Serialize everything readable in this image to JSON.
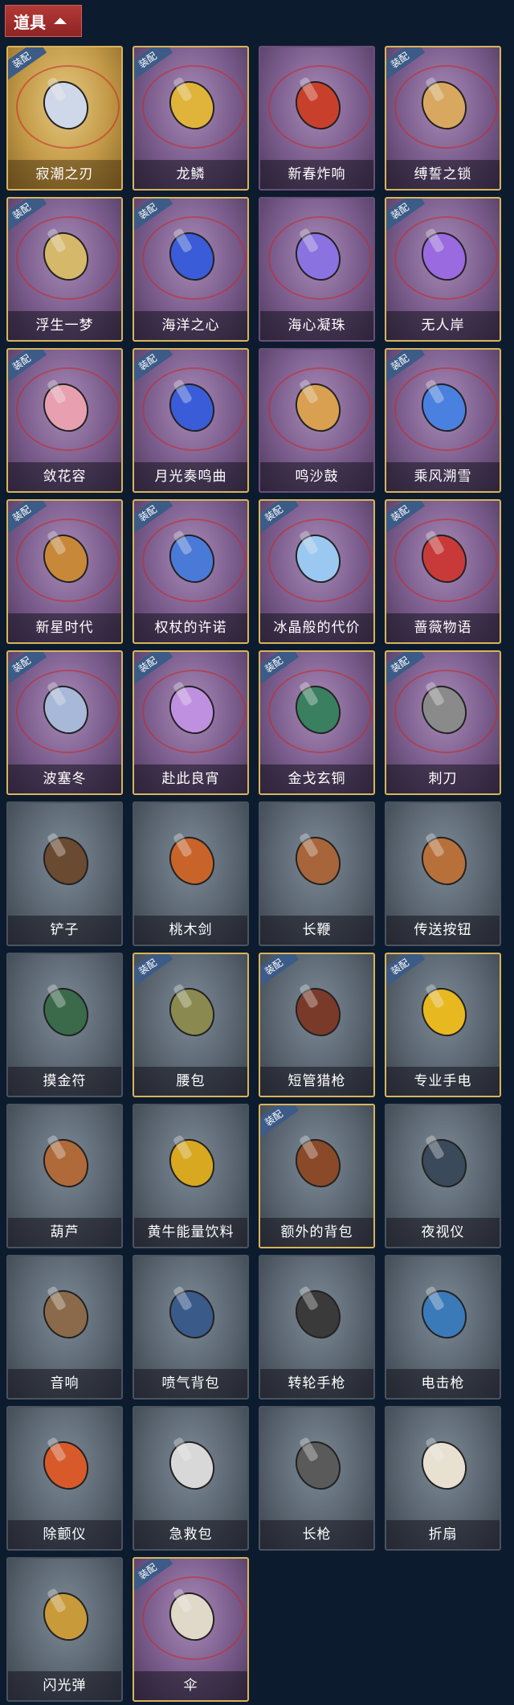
{
  "header": {
    "title": "道具"
  },
  "badge_text": "装配",
  "items": [
    {
      "label": "寂潮之刃",
      "style": "gold",
      "equipped": true,
      "icon": "blade-icon",
      "color": "#cfd8e8"
    },
    {
      "label": "龙鳞",
      "style": "purple",
      "equipped": true,
      "icon": "golden-shovel-icon",
      "color": "#e0b43a"
    },
    {
      "label": "新春炸响",
      "style": "purple",
      "equipped": false,
      "icon": "firecracker-whip-icon",
      "color": "#c8402c"
    },
    {
      "label": "缚誓之锁",
      "style": "purple",
      "equipped": true,
      "icon": "chain-lock-icon",
      "color": "#d8a860"
    },
    {
      "label": "浮生一梦",
      "style": "purple",
      "equipped": true,
      "icon": "scroll-icon",
      "color": "#d6b86a"
    },
    {
      "label": "海洋之心",
      "style": "purple",
      "equipped": true,
      "icon": "heart-necklace-icon",
      "color": "#3a5cd8"
    },
    {
      "label": "海心凝珠",
      "style": "purple",
      "equipped": false,
      "icon": "pearl-shell-icon",
      "color": "#8a72e0"
    },
    {
      "label": "无人岸",
      "style": "purple",
      "equipped": true,
      "icon": "perfume-bottle-icon",
      "color": "#9a6ae0"
    },
    {
      "label": "敛花容",
      "style": "purple",
      "equipped": true,
      "icon": "flower-hairpin-icon",
      "color": "#e8a0b0"
    },
    {
      "label": "月光奏鸣曲",
      "style": "purple",
      "equipped": true,
      "icon": "piano-icon",
      "color": "#3a5cd8"
    },
    {
      "label": "鸣沙鼓",
      "style": "purple",
      "equipped": false,
      "icon": "drum-icon",
      "color": "#d8a050"
    },
    {
      "label": "乘风溯雪",
      "style": "purple",
      "equipped": true,
      "icon": "lantern-icon",
      "color": "#4a80e0"
    },
    {
      "label": "新星时代",
      "style": "purple",
      "equipped": true,
      "icon": "revolver-icon",
      "color": "#c8883a"
    },
    {
      "label": "权杖的许诺",
      "style": "purple",
      "equipped": true,
      "icon": "scepter-icon",
      "color": "#4a7ad8"
    },
    {
      "label": "冰晶般的代价",
      "style": "purple",
      "equipped": true,
      "icon": "ice-lotus-icon",
      "color": "#9ac8f0"
    },
    {
      "label": "蔷薇物语",
      "style": "purple",
      "equipped": true,
      "icon": "medkit-icon",
      "color": "#c83a3a"
    },
    {
      "label": "波塞冬",
      "style": "purple",
      "equipped": true,
      "icon": "trident-icon",
      "color": "#a8b8d8"
    },
    {
      "label": "赴此良宵",
      "style": "purple",
      "equipped": true,
      "icon": "fan-lantern-icon",
      "color": "#c090e0"
    },
    {
      "label": "金戈玄铜",
      "style": "purple",
      "equipped": true,
      "icon": "bronze-grenade-icon",
      "color": "#3a8060"
    },
    {
      "label": "刺刀",
      "style": "purple",
      "equipped": true,
      "icon": "knife-icon",
      "color": "#8a8a8a"
    },
    {
      "label": "铲子",
      "style": "grey",
      "equipped": false,
      "icon": "shovel-icon",
      "color": "#6a4a30"
    },
    {
      "label": "桃木剑",
      "style": "grey",
      "equipped": false,
      "icon": "wooden-sword-icon",
      "color": "#c8642a"
    },
    {
      "label": "长鞭",
      "style": "grey",
      "equipped": false,
      "icon": "whip-icon",
      "color": "#a8643a"
    },
    {
      "label": "传送按钮",
      "style": "grey",
      "equipped": false,
      "icon": "remote-button-icon",
      "color": "#b8703a"
    },
    {
      "label": "摸金符",
      "style": "grey",
      "equipped": false,
      "icon": "tooth-amulet-icon",
      "color": "#3a6a4a"
    },
    {
      "label": "腰包",
      "style": "grey",
      "equipped": true,
      "icon": "waist-bag-icon",
      "color": "#8a8a50"
    },
    {
      "label": "短管猎枪",
      "style": "grey",
      "equipped": true,
      "icon": "shotgun-icon",
      "color": "#7a3a2a"
    },
    {
      "label": "专业手电",
      "style": "grey",
      "equipped": true,
      "icon": "flashlight-icon",
      "color": "#e8b820"
    },
    {
      "label": "葫芦",
      "style": "grey",
      "equipped": false,
      "icon": "gourd-icon",
      "color": "#b06a3a"
    },
    {
      "label": "黄牛能量饮料",
      "style": "grey",
      "equipped": false,
      "icon": "energy-drink-icon",
      "color": "#d8a820"
    },
    {
      "label": "额外的背包",
      "style": "grey",
      "equipped": true,
      "icon": "backpack-icon",
      "color": "#8a4a2a"
    },
    {
      "label": "夜视仪",
      "style": "grey",
      "equipped": false,
      "icon": "night-vision-icon",
      "color": "#3a4a5a"
    },
    {
      "label": "音响",
      "style": "grey",
      "equipped": false,
      "icon": "radio-icon",
      "color": "#8a6a4a"
    },
    {
      "label": "喷气背包",
      "style": "grey",
      "equipped": false,
      "icon": "jetpack-icon",
      "color": "#3a5a8a"
    },
    {
      "label": "转轮手枪",
      "style": "grey",
      "equipped": false,
      "icon": "pistol-icon",
      "color": "#3a3a3a"
    },
    {
      "label": "电击枪",
      "style": "grey",
      "equipped": false,
      "icon": "taser-gun-icon",
      "color": "#3a7ab8"
    },
    {
      "label": "除颤仪",
      "style": "grey",
      "equipped": false,
      "icon": "defibrillator-icon",
      "color": "#d85a2a"
    },
    {
      "label": "急救包",
      "style": "grey",
      "equipped": false,
      "icon": "first-aid-kit-icon",
      "color": "#d8d8d8"
    },
    {
      "label": "长枪",
      "style": "grey",
      "equipped": false,
      "icon": "spear-icon",
      "color": "#5a5a5a"
    },
    {
      "label": "折扇",
      "style": "grey",
      "equipped": false,
      "icon": "folding-fan-icon",
      "color": "#e8e0d0"
    },
    {
      "label": "闪光弹",
      "style": "grey",
      "equipped": false,
      "icon": "flashbang-icon",
      "color": "#c89a3a"
    },
    {
      "label": "伞",
      "style": "purple",
      "equipped": true,
      "icon": "umbrella-icon",
      "color": "#e0d8c8"
    }
  ]
}
